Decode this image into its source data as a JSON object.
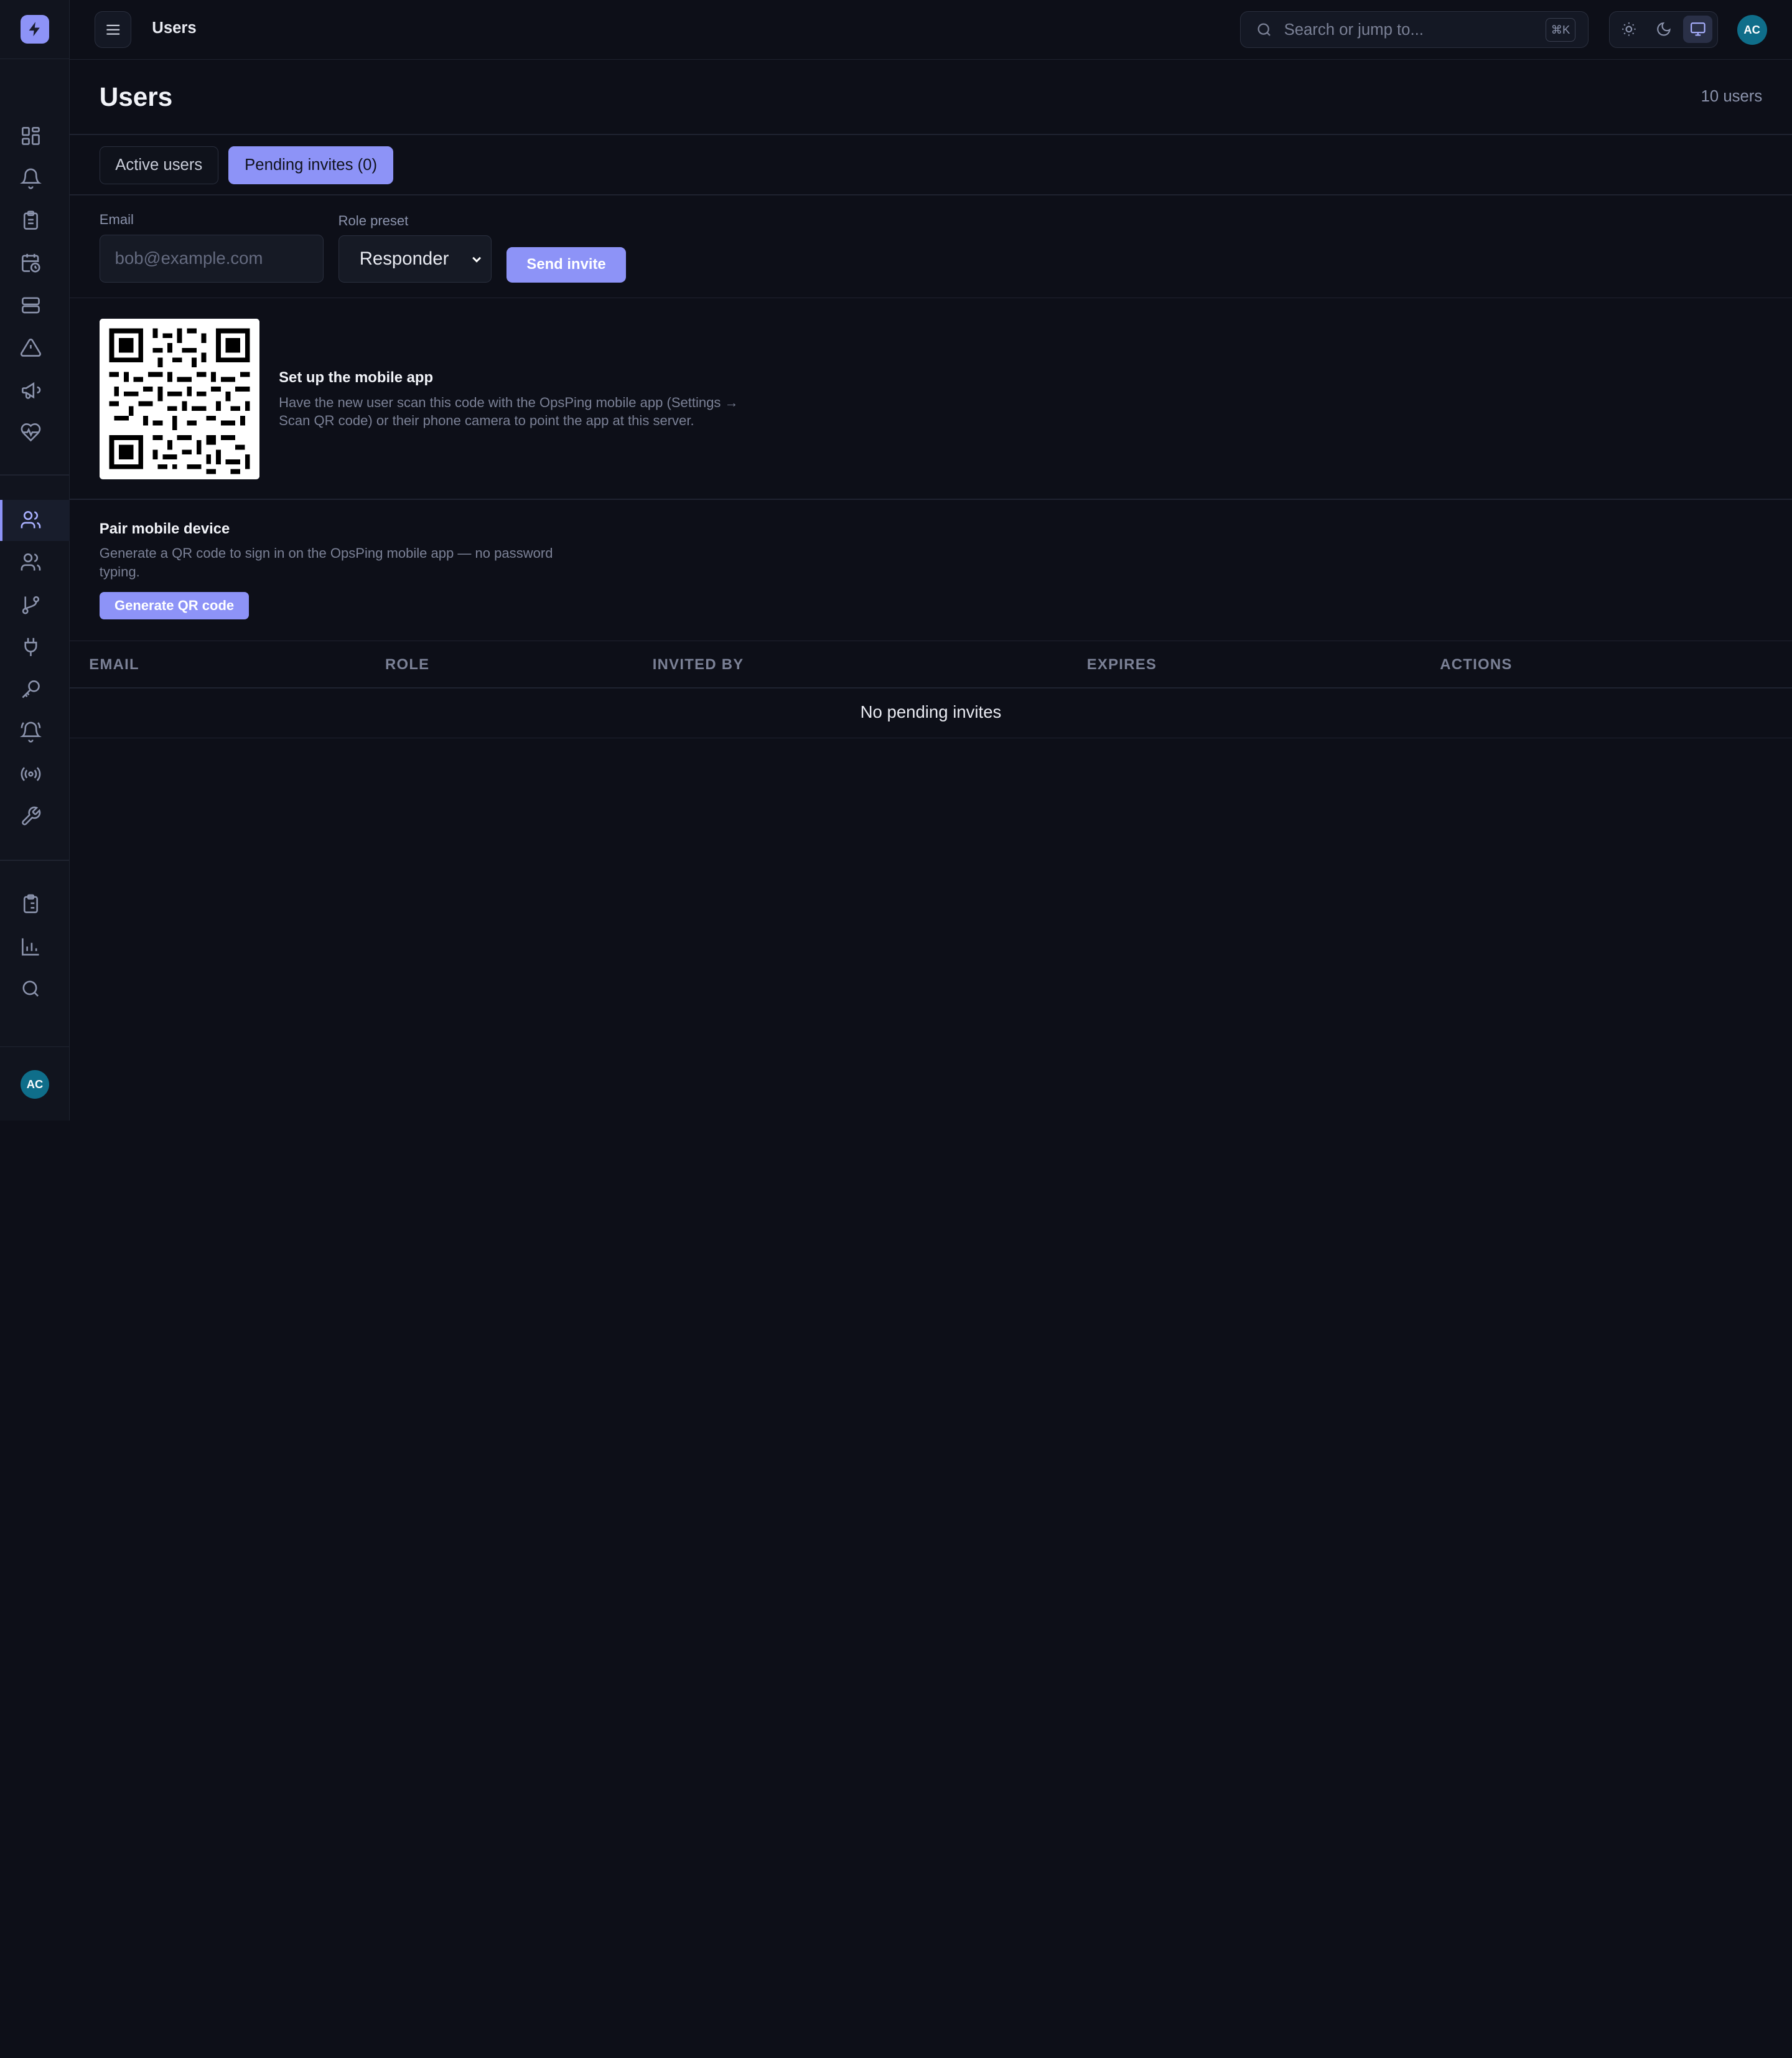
{
  "app": {
    "logo_icon": "bolt-icon",
    "user_initials": "AC"
  },
  "topbar": {
    "title": "Users",
    "search_placeholder": "Search or jump to...",
    "search_shortcut": "⌘K",
    "theme_options": [
      "sun-icon",
      "moon-icon",
      "monitor-icon"
    ],
    "active_theme": "monitor-icon"
  },
  "sidebar": {
    "items": [
      {
        "icon": "dashboard-icon"
      },
      {
        "icon": "bell-icon"
      },
      {
        "icon": "clipboard-icon"
      },
      {
        "icon": "calendar-clock-icon"
      },
      {
        "icon": "server-icon"
      },
      {
        "icon": "alert-triangle-icon"
      },
      {
        "icon": "megaphone-icon"
      },
      {
        "icon": "heart-pulse-icon"
      },
      {
        "icon": "user-icon",
        "active": true
      },
      {
        "icon": "users-icon"
      },
      {
        "icon": "git-branch-icon"
      },
      {
        "icon": "plug-icon"
      },
      {
        "icon": "key-icon"
      },
      {
        "icon": "bell-ring-icon"
      },
      {
        "icon": "broadcast-icon"
      },
      {
        "icon": "wrench-icon"
      },
      {
        "icon": "clipboard-list-icon"
      },
      {
        "icon": "bar-chart-icon"
      },
      {
        "icon": "search-icon"
      }
    ]
  },
  "page": {
    "title": "Users",
    "user_count": "10 users"
  },
  "tabs": [
    {
      "label": "Active users",
      "active": false
    },
    {
      "label": "Pending invites (0)",
      "active": true
    }
  ],
  "invite_form": {
    "email_label": "Email",
    "email_placeholder": "bob@example.com",
    "email_value": "",
    "role_label": "Role preset",
    "role_value": "Responder",
    "send_label": "Send invite"
  },
  "mobile_setup": {
    "title": "Set up the mobile app",
    "description": "Have the new user scan this code with the OpsPing mobile app (Settings → Scan QR code) or their phone camera to point the app at this server."
  },
  "pair_device": {
    "title": "Pair mobile device",
    "description": "Generate a QR code to sign in on the OpsPing mobile app — no password typing.",
    "button_label": "Generate QR code"
  },
  "invites_table": {
    "columns": [
      "EMAIL",
      "ROLE",
      "INVITED BY",
      "EXPIRES",
      "ACTIONS"
    ],
    "rows": [],
    "empty_message": "No pending invites"
  },
  "colors": {
    "accent": "#8d93f7",
    "background": "#0d0f18",
    "sidebar": "#11141e",
    "avatar": "#0f6e8a"
  }
}
